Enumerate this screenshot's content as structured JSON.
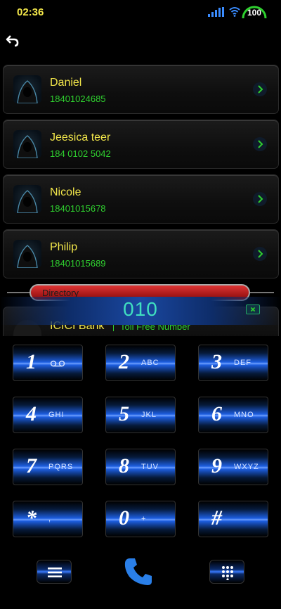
{
  "status": {
    "time": "02:36",
    "battery": "100",
    "icons": [
      "signal-icon",
      "wifi-icon",
      "battery-icon"
    ]
  },
  "header": {
    "back_icon": "back-arrow-icon"
  },
  "contacts": [
    {
      "name": "Daniel",
      "number": "18401024685"
    },
    {
      "name": "Jeesica teer",
      "number": "184 0102 5042"
    },
    {
      "name": "Nicole",
      "number": "18401015678"
    },
    {
      "name": "Philip",
      "number": "18401015689"
    }
  ],
  "directory": {
    "label": "Directory"
  },
  "dialer": {
    "number": "010"
  },
  "partial_contact": {
    "name": "ICICI Bank",
    "tag": "Toll Free Number"
  },
  "keypad": [
    {
      "digit": "1",
      "letters": ""
    },
    {
      "digit": "2",
      "letters": "ABC"
    },
    {
      "digit": "3",
      "letters": "DEF"
    },
    {
      "digit": "4",
      "letters": "GHI"
    },
    {
      "digit": "5",
      "letters": "JKL"
    },
    {
      "digit": "6",
      "letters": "MNO"
    },
    {
      "digit": "7",
      "letters": "PQRS"
    },
    {
      "digit": "8",
      "letters": "TUV"
    },
    {
      "digit": "9",
      "letters": "WXYZ"
    },
    {
      "digit": "*",
      "letters": ","
    },
    {
      "digit": "0",
      "letters": "+"
    },
    {
      "digit": "#",
      "letters": ""
    }
  ],
  "colors": {
    "name": "#f2e64a",
    "number": "#2fd02f",
    "dial_number": "#40e0c0",
    "accent_blue": "#1d5ee0",
    "directory_red": "#d33"
  }
}
